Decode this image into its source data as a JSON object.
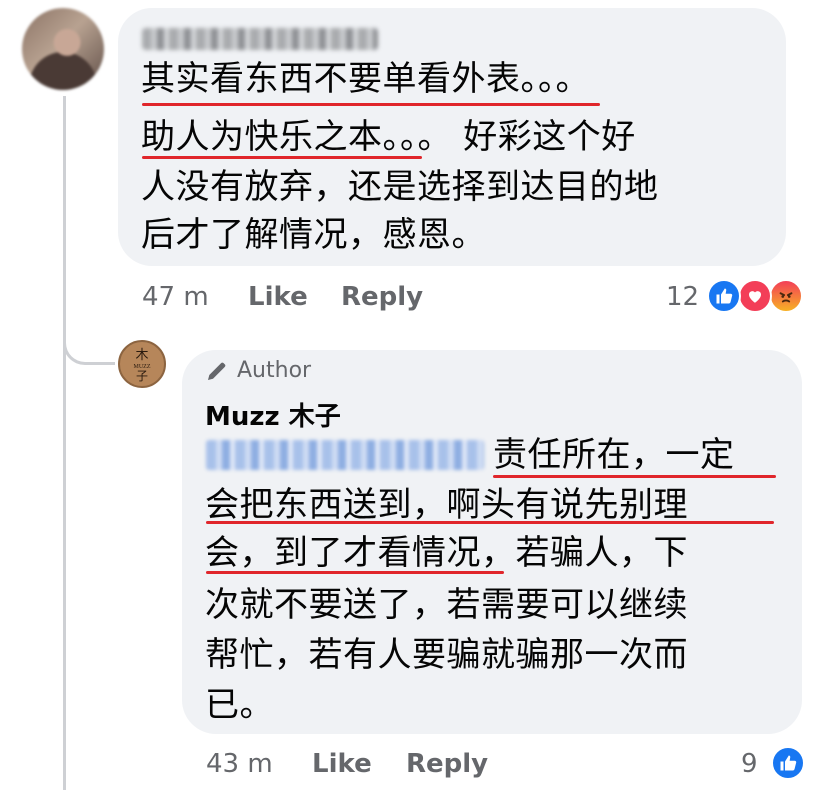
{
  "comment": {
    "text_lines": [
      "其实看东西不要单看外表。。。。",
      "助人为快乐之本。。。。 好彩这个好",
      "人没有放弃，还是选择到达目的地",
      "后才了解情况，感恩。"
    ],
    "line1_main": "其实看东西不要单看外表",
    "line1_tail": "。。。",
    "line2_main": "助人为快乐之本",
    "line2_tail": "。。。 好彩这个好",
    "line3": "人没有放弃，还是选择到达目的地",
    "line4": "后才了解情况，感恩。",
    "time": "47 m",
    "like_label": "Like",
    "reply_label": "Reply",
    "reaction_count": "12",
    "reactions": [
      "like-icon",
      "love-icon",
      "angry-icon"
    ],
    "colors": {
      "like": "#1877f2",
      "love": "#f33e58",
      "angry": "#e9710f"
    }
  },
  "reply": {
    "author_badge": "Author",
    "author_name": "Muzz 木子",
    "line1": "责任所在，一定",
    "line2": "会把东西送到，啊头有说先别理",
    "line3": "会，到了才看情况，若骗人，下",
    "line4": "次就不要送了，若需要可以继续",
    "line5": "帮忙，若有人要骗就骗那一次而",
    "line6": "已。",
    "time": "43 m",
    "like_label": "Like",
    "reply_label": "Reply",
    "reaction_count": "9",
    "reactions": [
      "like-icon"
    ]
  },
  "colors": {
    "bubble": "#f0f2f5",
    "underline": "#e0262b",
    "meta_text": "#65676b",
    "tag_blue": "#1877f2"
  }
}
